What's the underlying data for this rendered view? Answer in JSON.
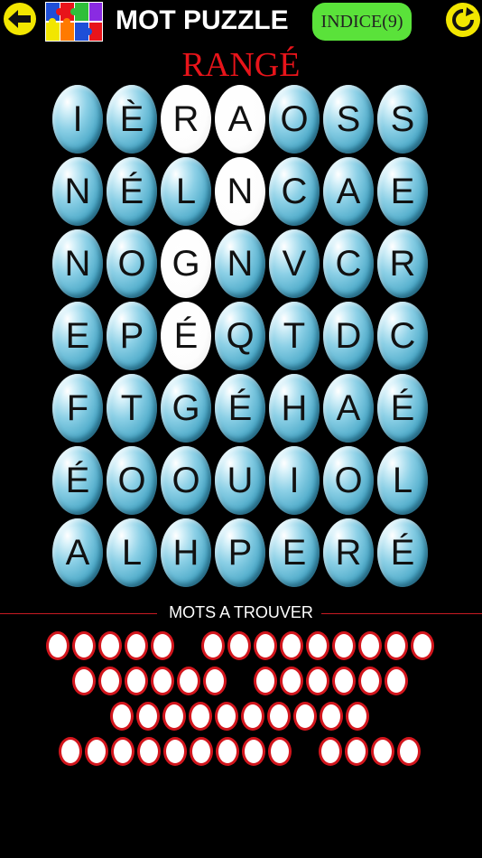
{
  "header": {
    "back_icon": "arrow-left-icon",
    "logo_icon": "puzzle-pieces-icon",
    "title": "MOT PUZZLE",
    "hint_label": "INDICE(9)",
    "reload_icon": "refresh-icon"
  },
  "found_word": "RANGÉ",
  "grid": {
    "rows": [
      [
        "I",
        "È",
        "R",
        "A",
        "O",
        "S",
        "S"
      ],
      [
        "N",
        "É",
        "L",
        "N",
        "C",
        "A",
        "E"
      ],
      [
        "N",
        "O",
        "G",
        "N",
        "V",
        "C",
        "R"
      ],
      [
        "E",
        "P",
        "É",
        "Q",
        "T",
        "D",
        "C"
      ],
      [
        "F",
        "T",
        "G",
        "É",
        "H",
        "A",
        "É"
      ],
      [
        "É",
        "O",
        "O",
        "U",
        "I",
        "O",
        "L"
      ],
      [
        "A",
        "L",
        "H",
        "P",
        "E",
        "R",
        "É"
      ]
    ],
    "selected": [
      [
        0,
        2
      ],
      [
        0,
        3
      ],
      [
        1,
        3
      ],
      [
        2,
        2
      ],
      [
        3,
        2
      ]
    ]
  },
  "words_section": {
    "label": "MOTS A TROUVER",
    "word_lengths": [
      [
        5,
        9
      ],
      [
        6,
        6
      ],
      [
        10
      ],
      [
        9,
        4
      ]
    ]
  },
  "colors": {
    "background": "#000000",
    "accent_yellow": "#f2e600",
    "hint_green": "#5ae23a",
    "found_red": "#e8141a"
  }
}
